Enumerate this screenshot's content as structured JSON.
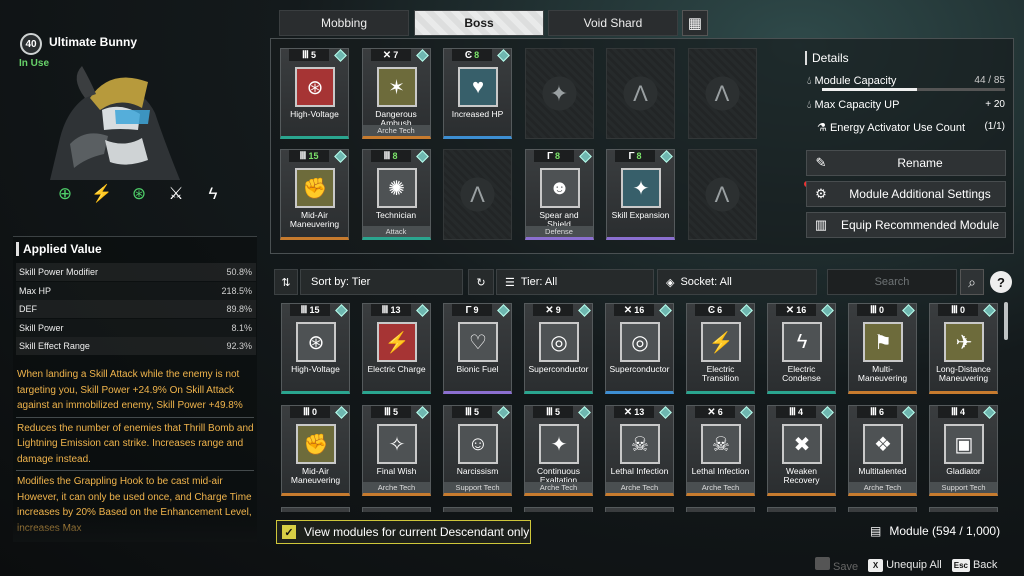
{
  "character": {
    "level": "40",
    "name": "Ultimate Bunny",
    "status": "In Use",
    "skills": [
      {
        "icon": "target-burst-icon",
        "glyph": "⊕",
        "color": "#4fd06a"
      },
      {
        "icon": "lightning-dash-icon",
        "glyph": "⚡",
        "color": "#ffffff"
      },
      {
        "icon": "lightning-orb-icon",
        "glyph": "⊛",
        "color": "#4fd06a"
      },
      {
        "icon": "kick-lightning-icon",
        "glyph": "⚔",
        "color": "#ffffff"
      },
      {
        "icon": "twin-lightning-icon",
        "glyph": "ϟ",
        "color": "#ffffff"
      }
    ]
  },
  "applied": {
    "title": "Applied Value",
    "stats": [
      {
        "label": "Skill Power Modifier",
        "value": "50.8%"
      },
      {
        "label": "Max HP",
        "value": "218.5%"
      },
      {
        "label": "DEF",
        "value": "89.8%"
      },
      {
        "label": "Skill Power",
        "value": "8.1%"
      },
      {
        "label": "Skill Effect Range",
        "value": "92.3%"
      }
    ],
    "effects": [
      "When landing a Skill Attack while the enemy is not targeting you, Skill Power +24.9% On Skill Attack against an immobilized enemy, Skill Power +49.8%",
      "Reduces the number of enemies that Thrill Bomb and Lightning Emission can strike. Increases range and damage instead.",
      "Modifies the Grappling Hook to be cast mid-air However, it can only be used once, and Charge Time increases by 20% Based on the Enhancement Level, increases Max"
    ]
  },
  "tabs": [
    {
      "label": "Mobbing"
    },
    {
      "label": "Boss"
    },
    {
      "label": "Void Shard"
    }
  ],
  "equipped": [
    {
      "cap_glyph": "Ⅲ",
      "cap": "5",
      "art": "⊛",
      "art_bg": "red",
      "name": "High-Voltage",
      "sub": "",
      "rarity": "teal",
      "green": false
    },
    {
      "cap_glyph": "✕",
      "cap": "7",
      "art": "✶",
      "art_bg": "olive",
      "name": "Dangerous Ambush",
      "sub": "Arche Tech",
      "rarity": "gold",
      "green": false
    },
    {
      "cap_glyph": "Ͼ",
      "cap": "8",
      "art": "♥",
      "art_bg": "teal",
      "name": "Increased HP",
      "sub": "",
      "rarity": "blue",
      "green": true
    },
    {
      "empty": true,
      "glyph": "✦"
    },
    {
      "empty": true,
      "glyph": "Λ"
    },
    {
      "empty": true,
      "glyph": "Λ"
    },
    {
      "cap_glyph": "Ⅲ",
      "cap": "15",
      "art": "✊",
      "art_bg": "olive",
      "name": "Mid-Air Maneuvering",
      "sub": "",
      "rarity": "gold",
      "green": true
    },
    {
      "cap_glyph": "Ⅲ",
      "cap": "8",
      "art": "✺",
      "art_bg": "grey",
      "name": "Technician",
      "sub": "Attack",
      "rarity": "teal",
      "green": true
    },
    {
      "empty": true,
      "glyph": "Λ"
    },
    {
      "cap_glyph": "Γ",
      "cap": "8",
      "art": "☻",
      "art_bg": "grey",
      "name": "Spear and Shield",
      "sub": "Defense",
      "rarity": "purple",
      "green": true
    },
    {
      "cap_glyph": "Γ",
      "cap": "8",
      "art": "✦",
      "art_bg": "teal",
      "name": "Skill Expansion",
      "sub": "",
      "rarity": "purple",
      "green": true
    },
    {
      "empty": true,
      "glyph": "Λ"
    }
  ],
  "details": {
    "title": "Details",
    "capacity_label": "Module Capacity",
    "capacity_value": "44 / 85",
    "capacity_fraction": 0.52,
    "max_up_label": "Max Capacity UP",
    "max_up_value": "+ 20",
    "activator_label": "Energy Activator Use Count",
    "activator_value": "(1/1)",
    "buttons": [
      {
        "label": "Rename",
        "icon": "✎"
      },
      {
        "label": "Module Additional Settings",
        "icon": "⚙"
      },
      {
        "label": "Equip Recommended Module",
        "icon": "▥"
      }
    ]
  },
  "toolbar": {
    "sort_label": "Sort by: Tier",
    "tier_label": "Tier: All",
    "socket_label": "Socket: All",
    "search_placeholder": "Search",
    "help": "?"
  },
  "inventory_rows": [
    [
      {
        "cap_glyph": "Ⅲ",
        "cap": "15",
        "art": "⊛",
        "art_bg": "grey",
        "name": "High-Voltage",
        "sub": "",
        "rarity": "teal"
      },
      {
        "cap_glyph": "Ⅲ",
        "cap": "13",
        "art": "⚡",
        "art_bg": "red",
        "name": "Electric Charge",
        "sub": "",
        "rarity": "teal"
      },
      {
        "cap_glyph": "Γ",
        "cap": "9",
        "art": "♡",
        "art_bg": "grey",
        "name": "Bionic Fuel",
        "sub": "",
        "rarity": "purple"
      },
      {
        "cap_glyph": "✕",
        "cap": "9",
        "art": "◎",
        "art_bg": "grey",
        "name": "Superconductor",
        "sub": "",
        "rarity": "teal"
      },
      {
        "cap_glyph": "✕",
        "cap": "16",
        "art": "◎",
        "art_bg": "grey",
        "name": "Superconductor",
        "sub": "",
        "rarity": "blue"
      },
      {
        "cap_glyph": "Ͼ",
        "cap": "6",
        "art": "⚡",
        "art_bg": "grey",
        "name": "Electric Transition",
        "sub": "",
        "rarity": "teal"
      },
      {
        "cap_glyph": "✕",
        "cap": "16",
        "art": "ϟ",
        "art_bg": "grey",
        "name": "Electric Condense",
        "sub": "",
        "rarity": "teal"
      },
      {
        "cap_glyph": "Ⅲ",
        "cap": "0",
        "art": "⚑",
        "art_bg": "olive",
        "name": "Multi-Maneuvering",
        "sub": "",
        "rarity": "gold"
      },
      {
        "cap_glyph": "Ⅲ",
        "cap": "0",
        "art": "✈",
        "art_bg": "olive",
        "name": "Long-Distance Maneuvering",
        "sub": "",
        "rarity": "gold"
      }
    ],
    [
      {
        "cap_glyph": "Ⅲ",
        "cap": "0",
        "art": "✊",
        "art_bg": "olive",
        "name": "Mid-Air Maneuvering",
        "sub": "",
        "rarity": "gold"
      },
      {
        "cap_glyph": "Ⅲ",
        "cap": "5",
        "art": "✧",
        "art_bg": "grey",
        "name": "Final Wish",
        "sub": "Arche Tech",
        "rarity": "gold"
      },
      {
        "cap_glyph": "Ⅲ",
        "cap": "5",
        "art": "☺",
        "art_bg": "grey",
        "name": "Narcissism",
        "sub": "Support Tech",
        "rarity": "gold"
      },
      {
        "cap_glyph": "Ⅲ",
        "cap": "5",
        "art": "✦",
        "art_bg": "grey",
        "name": "Continuous Exaltation",
        "sub": "Arche Tech",
        "rarity": "gold"
      },
      {
        "cap_glyph": "✕",
        "cap": "13",
        "art": "☠",
        "art_bg": "grey",
        "name": "Lethal Infection",
        "sub": "Arche Tech",
        "rarity": "gold"
      },
      {
        "cap_glyph": "✕",
        "cap": "6",
        "art": "☠",
        "art_bg": "grey",
        "name": "Lethal Infection",
        "sub": "Arche Tech",
        "rarity": "gold"
      },
      {
        "cap_glyph": "Ⅲ",
        "cap": "4",
        "art": "✖",
        "art_bg": "grey",
        "name": "Weaken Recovery",
        "sub": "",
        "rarity": "gold"
      },
      {
        "cap_glyph": "Ⅲ",
        "cap": "6",
        "art": "❖",
        "art_bg": "grey",
        "name": "Multitalented",
        "sub": "Arche Tech",
        "rarity": "gold"
      },
      {
        "cap_glyph": "Ⅲ",
        "cap": "4",
        "art": "▣",
        "art_bg": "grey",
        "name": "Gladiator",
        "sub": "Support Tech",
        "rarity": "gold"
      }
    ]
  ],
  "bottom": {
    "view_label": "View modules for current Descendant only",
    "check_mark": "✓",
    "module_count": "Module (594 / 1,000)"
  },
  "footer": {
    "save_key": "",
    "save_label": "Save",
    "unequip_key": "X",
    "unequip_label": "Unequip All",
    "back_key": "Esc",
    "back_label": "Back"
  }
}
